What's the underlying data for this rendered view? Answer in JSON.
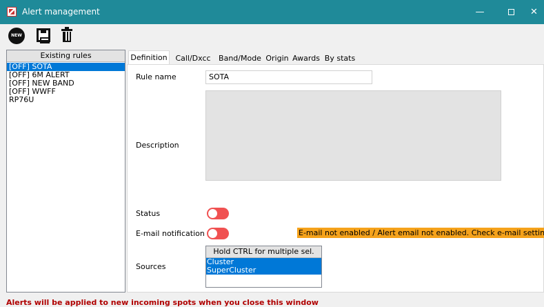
{
  "window": {
    "title": "Alert management",
    "controls": {
      "minimize": "—",
      "maximize_icon": "maximize-icon",
      "close": "✕"
    }
  },
  "toolbar": {
    "new_badge": "NEW",
    "buttons": [
      {
        "name": "new-rule-button",
        "icon": "new-burst-icon"
      },
      {
        "name": "save-button",
        "icon": "floppy-disk-icon"
      },
      {
        "name": "delete-button",
        "icon": "trash-icon"
      }
    ]
  },
  "rules": {
    "header": "Existing rules",
    "items": [
      "[OFF] SOTA",
      "[OFF] 6M ALERT",
      "[OFF] NEW BAND",
      "[OFF] WWFF",
      "RP76U"
    ],
    "selected_index": 0
  },
  "tabs": [
    "Definition",
    "Call/Dxcc",
    "Band/Mode",
    "Origin",
    "Awards",
    "By stats"
  ],
  "active_tab": "Definition",
  "definition": {
    "rule_name_label": "Rule name",
    "rule_name_value": "SOTA",
    "description_label": "Description",
    "status_label": "Status",
    "status_on": false,
    "email_label": "E-mail notification",
    "email_on": false,
    "email_warning": "E-mail not enabled / Alert email not enabled. Check e-mail settings",
    "sources_label": "Sources",
    "sources_header": "Hold CTRL for multiple sel.",
    "sources": [
      "Cluster",
      "SuperCluster"
    ]
  },
  "footer_message": "Alerts will be applied to new incoming spots when you close this window",
  "colors": {
    "titlebar": "#1f8a99",
    "selection": "#0078d7",
    "toggle_off": "#f05151",
    "warning_bg": "#f5a21b",
    "footer_text": "#b00000"
  }
}
